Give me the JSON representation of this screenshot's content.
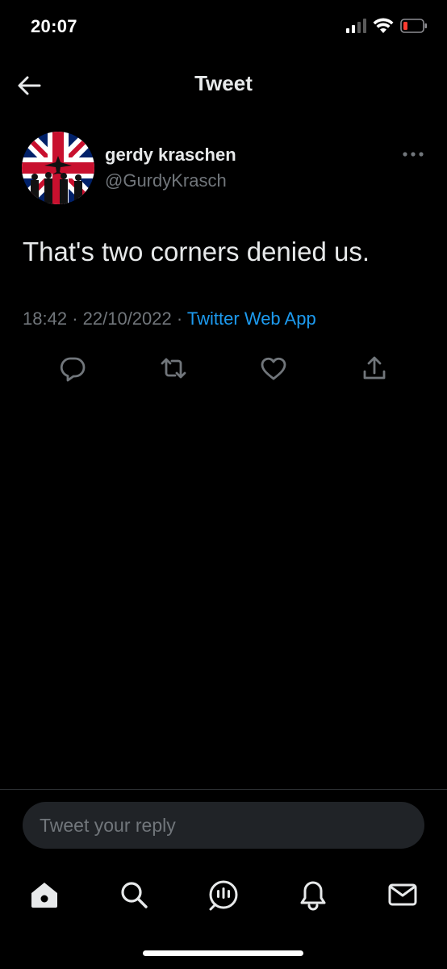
{
  "status_bar": {
    "time": "20:07",
    "icons": [
      "signal-icon",
      "wifi-icon",
      "battery-low-icon"
    ],
    "battery_color": "#ff3b30"
  },
  "header": {
    "title": "Tweet",
    "back_icon": "back-arrow-icon"
  },
  "tweet": {
    "author_name": "gerdy kraschen",
    "author_handle": "@GurdyKrasch",
    "text": "That's two corners denied us.",
    "time": "18:42",
    "date": "22/10/2022",
    "separator": "·",
    "source": "Twitter Web App"
  },
  "actions": [
    "reply-icon",
    "retweet-icon",
    "like-icon",
    "share-icon"
  ],
  "reply": {
    "placeholder": "Tweet your reply"
  },
  "tab_bar": [
    "home-icon",
    "search-icon",
    "spaces-icon",
    "notifications-icon",
    "messages-icon"
  ],
  "colors": {
    "background": "#000000",
    "text": "#e7e9ea",
    "muted": "#71767b",
    "link": "#1d9bf0",
    "divider": "#2f3336",
    "reply_bg": "#202327"
  }
}
